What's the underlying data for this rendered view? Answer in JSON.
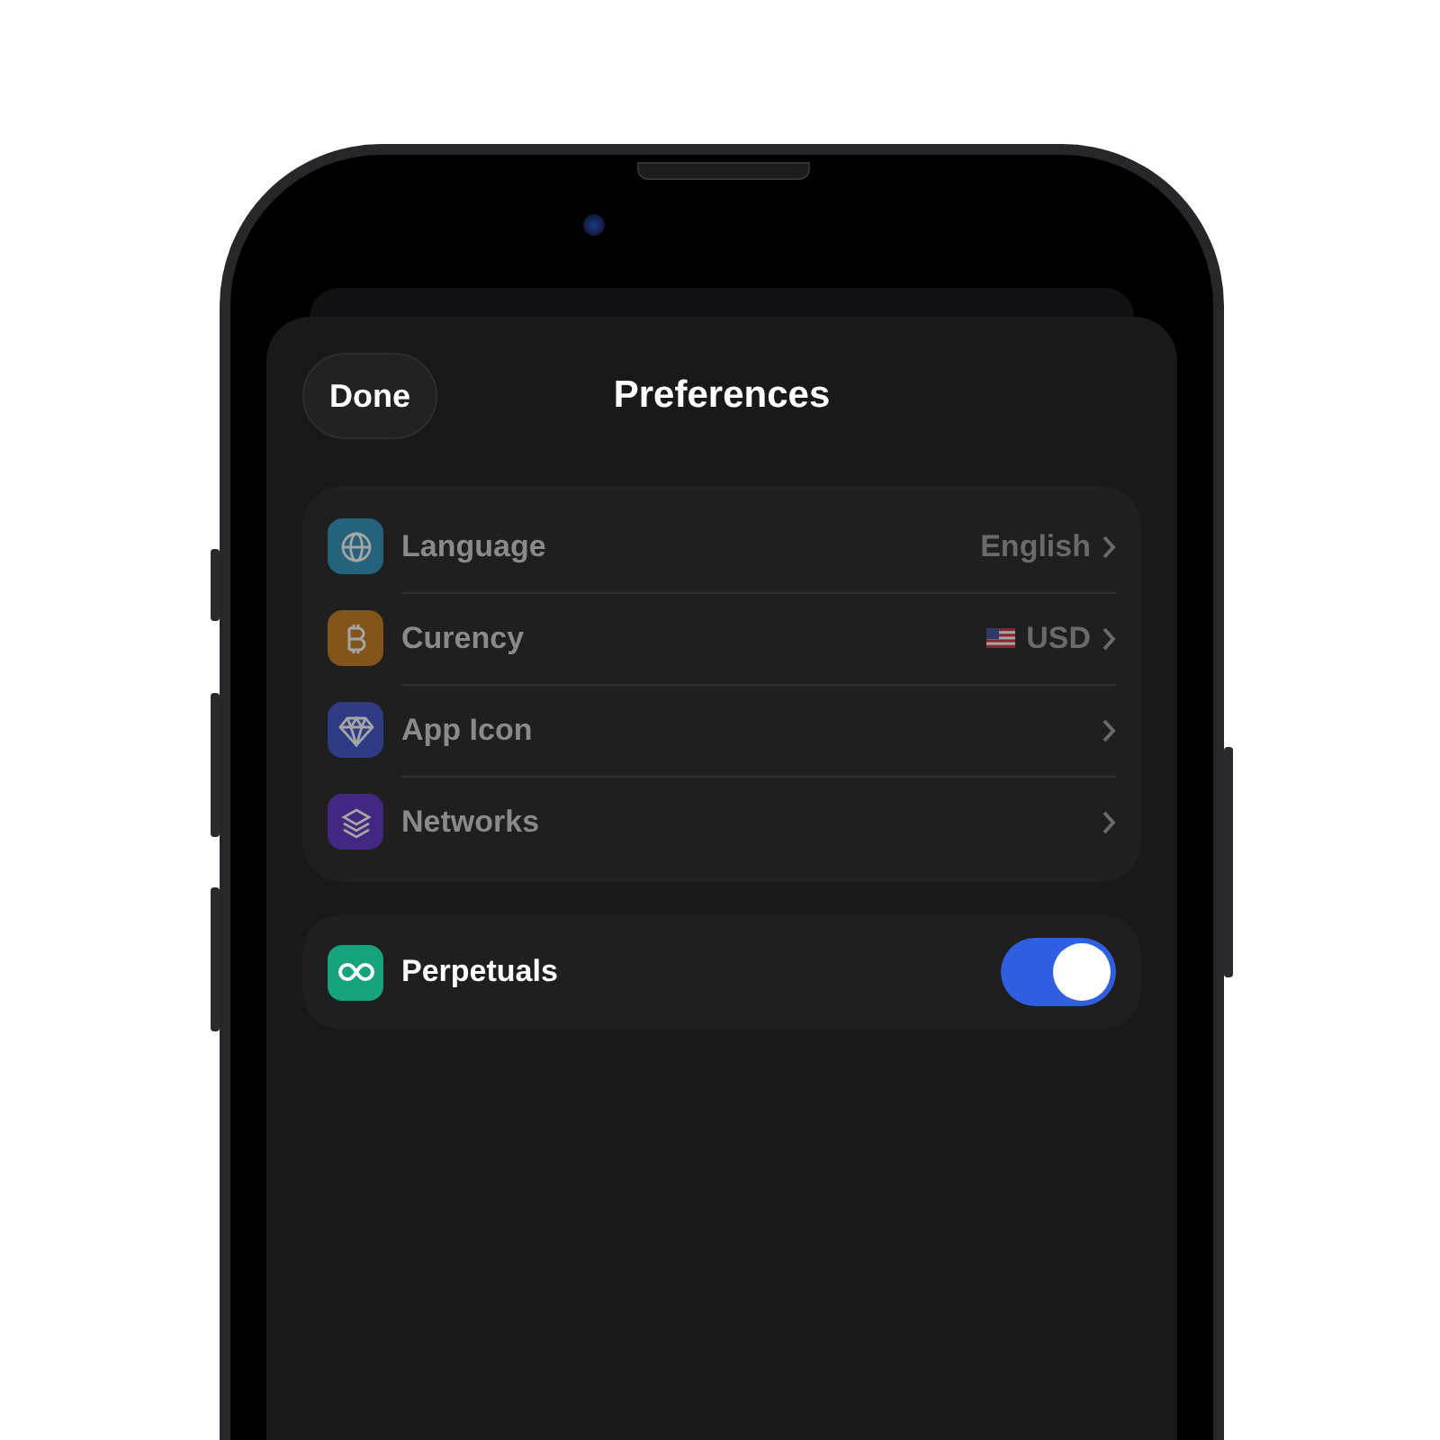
{
  "header": {
    "done_button": "Done",
    "title": "Preferences"
  },
  "settings": [
    {
      "kind": "globe",
      "label": "Language",
      "value": "English",
      "flag": false,
      "disabled": true
    },
    {
      "kind": "coin",
      "label": "Curency",
      "value": "USD",
      "flag": true,
      "disabled": true
    },
    {
      "kind": "gem",
      "label": "App Icon",
      "flag": false,
      "disabled": true
    },
    {
      "kind": "layers",
      "label": "Networks",
      "flag": false,
      "disabled": true
    }
  ],
  "toggles": [
    {
      "kind": "infinity",
      "label": "Perpetuals",
      "on": true
    }
  ]
}
